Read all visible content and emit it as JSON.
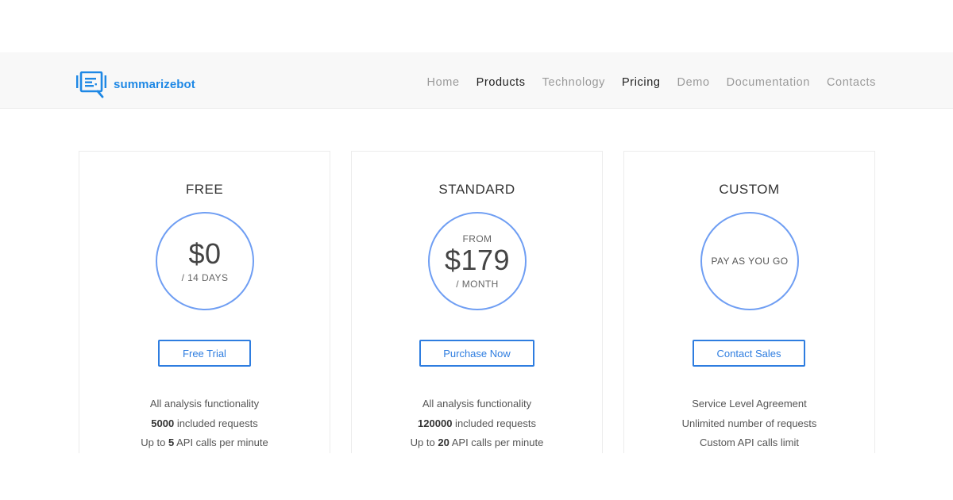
{
  "header": {
    "logo_text": "summarizebot",
    "nav": [
      {
        "label": "Home",
        "active": false
      },
      {
        "label": "Products",
        "active": true
      },
      {
        "label": "Technology",
        "active": false
      },
      {
        "label": "Pricing",
        "active": true
      },
      {
        "label": "Demo",
        "active": false
      },
      {
        "label": "Documentation",
        "active": false
      },
      {
        "label": "Contacts",
        "active": false
      }
    ]
  },
  "colors": {
    "brand": "#1e88e5",
    "circle_border": "#6f9ef3",
    "button_border": "#2e7de0"
  },
  "plans": [
    {
      "name": "FREE",
      "price": "$0",
      "period": "/ 14 DAYS",
      "button": "Free Trial",
      "features": [
        {
          "pre": "All analysis functionality",
          "bold": "",
          "post": ""
        },
        {
          "pre": "",
          "bold": "5000",
          "post": " included requests"
        },
        {
          "pre": "Up to ",
          "bold": "5",
          "post": " API calls per minute"
        }
      ]
    },
    {
      "name": "STANDARD",
      "from": "FROM",
      "price": "$179",
      "period": "/ MONTH",
      "button": "Purchase Now",
      "features": [
        {
          "pre": "All analysis functionality",
          "bold": "",
          "post": ""
        },
        {
          "pre": "",
          "bold": "120000",
          "post": " included requests"
        },
        {
          "pre": "Up to ",
          "bold": "20",
          "post": " API calls per minute"
        }
      ]
    },
    {
      "name": "CUSTOM",
      "price_text": "PAY AS YOU GO",
      "button": "Contact Sales",
      "features": [
        {
          "pre": "Service Level Agreement",
          "bold": "",
          "post": ""
        },
        {
          "pre": "Unlimited number of requests",
          "bold": "",
          "post": ""
        },
        {
          "pre": "Custom API calls limit",
          "bold": "",
          "post": ""
        }
      ]
    }
  ]
}
